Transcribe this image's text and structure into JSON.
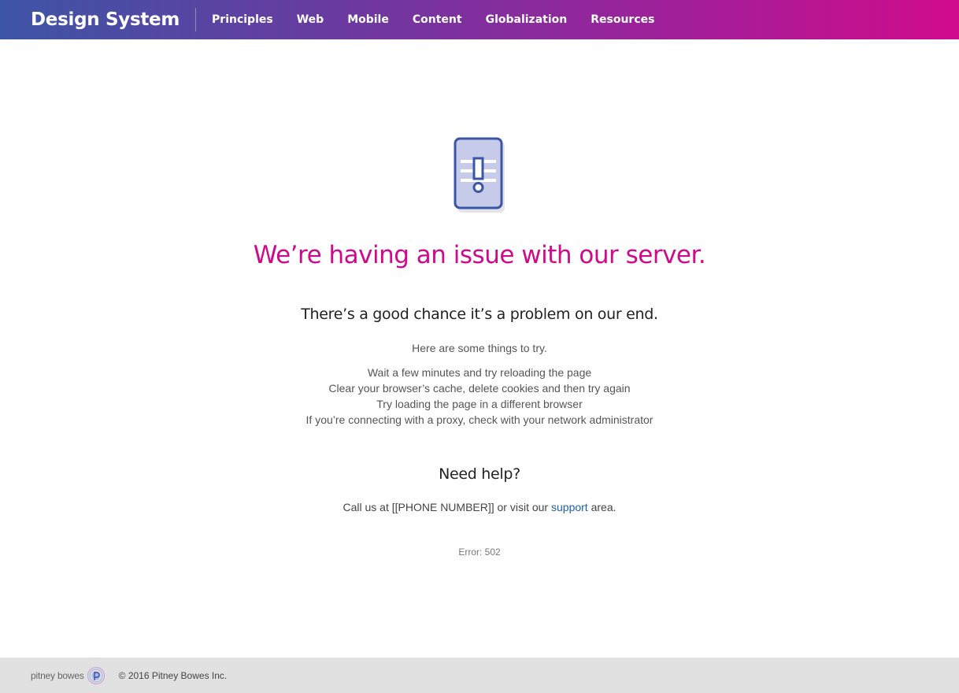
{
  "nav": {
    "brand": "Design System",
    "links": [
      "Principles",
      "Web",
      "Mobile",
      "Content",
      "Globalization",
      "Resources"
    ]
  },
  "main": {
    "icon": "server-alert-icon",
    "headline": "We’re having an issue with our server.",
    "subhead": "There’s a good chance it’s a problem on our end.",
    "intro": "Here are some things to try.",
    "tips": [
      "Wait a few minutes and try reloading the page",
      "Clear your browser’s cache, delete cookies and then try again",
      "Try loading the page in a different browser",
      "If you’re connecting with a proxy, check with your network administrator"
    ],
    "help_title": "Need help?",
    "help_prefix": "Call us at [[PHONE NUMBER]] or visit our ",
    "help_link": "support",
    "help_suffix": " area.",
    "error": "Error: 502"
  },
  "footer": {
    "logo_text": "pitney bowes",
    "logo_icon": "pitney-bowes-logo-icon",
    "copyright": "© 2016 Pitney Bowes Inc."
  },
  "colors": {
    "headline": "#cf0a8a",
    "nav_gradient_start": "#3d55a6",
    "nav_gradient_end": "#d10b8c",
    "link": "#1f5fa8",
    "footer_bg": "#e1e1e1"
  }
}
